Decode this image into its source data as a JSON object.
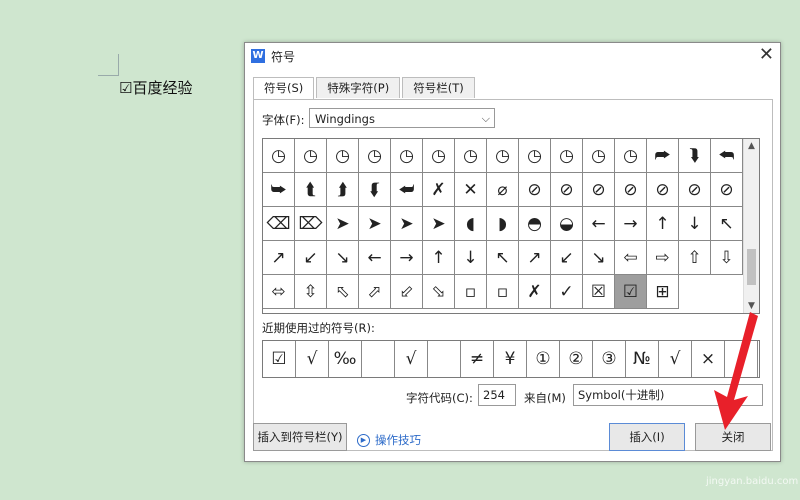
{
  "document": {
    "text": "☑百度经验"
  },
  "dialog": {
    "title": "符号",
    "tabs": [
      "符号(S)",
      "特殊字符(P)",
      "符号栏(T)"
    ],
    "font_label": "字体(F):",
    "font_value": "Wingdings",
    "grid_symbols": [
      "◷",
      "◷",
      "◷",
      "◷",
      "◷",
      "◷",
      "◷",
      "◷",
      "◷",
      "◷",
      "◷",
      "◷",
      "⮫",
      "⮯",
      "⮪",
      "⮩",
      "⮬",
      "⮭",
      "⮮",
      "⮨",
      "✗",
      "✕",
      "⌀",
      "⊘",
      "⊘",
      "⊘",
      "⊘",
      "⊘",
      "⊘",
      "⊘",
      "⌫",
      "⌦",
      "➤",
      "➤",
      "➤",
      "➤",
      "◖",
      "◗",
      "◓",
      "◒",
      "←",
      "→",
      "↑",
      "↓",
      "↖",
      "↗",
      "↙",
      "↘",
      "←",
      "→",
      "↑",
      "↓",
      "↖",
      "↗",
      "↙",
      "↘",
      "⇦",
      "⇨",
      "⇧",
      "⇩",
      "⬄",
      "⇳",
      "⬁",
      "⬀",
      "⬃",
      "⬂",
      "▫",
      "▫",
      "✗",
      "✓",
      "☒",
      "☑",
      "⊞"
    ],
    "selected_symbol": "☑",
    "recent_label": "近期使用过的符号(R):",
    "recent_symbols": [
      "☑",
      "√",
      "‰",
      "",
      "√",
      "",
      "≠",
      "¥",
      "①",
      "②",
      "③",
      "№",
      "√",
      "×",
      "↓"
    ],
    "code_label": "字符代码(C):",
    "code_value": "254",
    "from_label": "来自(M)",
    "from_value": "Symbol(十进制)",
    "add_to_bar_button": "插入到符号栏(Y)",
    "tips_link": "操作技巧",
    "insert_button": "插入(I)",
    "close_button": "关闭"
  },
  "watermark": "jingyan.baidu.com",
  "colors": {
    "annotation_arrow": "#e8202a",
    "link": "#2d6bc9"
  }
}
